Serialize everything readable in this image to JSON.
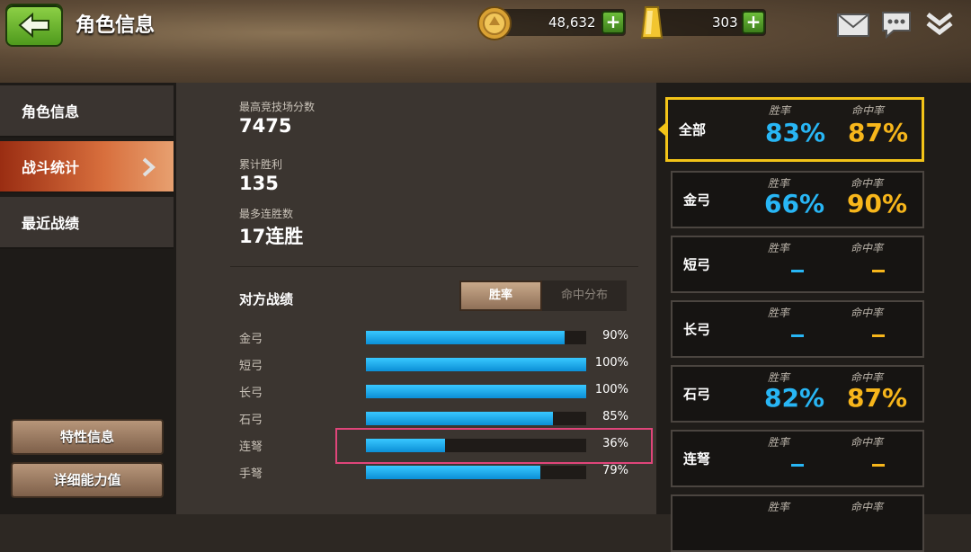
{
  "header": {
    "title": "角色信息",
    "coins": "48,632",
    "gold": "303",
    "plus": "+"
  },
  "sidebar": {
    "items": [
      {
        "label": "角色信息"
      },
      {
        "label": "战斗统计"
      },
      {
        "label": "最近战绩"
      }
    ],
    "active_index": 1,
    "traits_button": "特性信息",
    "details_button": "详细能力值"
  },
  "stats": {
    "top_score_label": "最高竞技场分数",
    "top_score": "7475",
    "total_wins_label": "累计胜利",
    "total_wins": "135",
    "max_streak_label": "最多连胜数",
    "max_streak": "17连胜"
  },
  "opponents": {
    "title": "对方战绩",
    "tabs": [
      "胜率",
      "命中分布"
    ],
    "active_tab": 0,
    "rows": [
      {
        "label": "金弓",
        "value": 90,
        "pct": "90%"
      },
      {
        "label": "短弓",
        "value": 100,
        "pct": "100%"
      },
      {
        "label": "长弓",
        "value": 100,
        "pct": "100%"
      },
      {
        "label": "石弓",
        "value": 85,
        "pct": "85%"
      },
      {
        "label": "连弩",
        "value": 36,
        "pct": "36%"
      },
      {
        "label": "手弩",
        "value": 79,
        "pct": "79%"
      }
    ]
  },
  "weapons": {
    "win_label": "胜率",
    "hit_label": "命中率",
    "cards": [
      {
        "name": "全部",
        "win": "83%",
        "hit": "87%"
      },
      {
        "name": "金弓",
        "win": "66%",
        "hit": "90%"
      },
      {
        "name": "短弓",
        "win": "",
        "hit": ""
      },
      {
        "name": "长弓",
        "win": "",
        "hit": ""
      },
      {
        "name": "石弓",
        "win": "82%",
        "hit": "87%"
      },
      {
        "name": "连弩",
        "win": "",
        "hit": ""
      },
      {
        "name": "",
        "win": "",
        "hit": ""
      }
    ]
  },
  "colors": {
    "bar": "#1aa8ea",
    "win": "#28b6f5",
    "hit": "#f7b61b",
    "selected_border": "#f3c418",
    "highlight_box": "#e0457a"
  },
  "icons": [
    "back-arrow-icon",
    "coin-icon",
    "gold-bar-icon",
    "plus-icon",
    "mail-icon",
    "chat-icon",
    "collapse-icon",
    "chevron-right-icon"
  ]
}
